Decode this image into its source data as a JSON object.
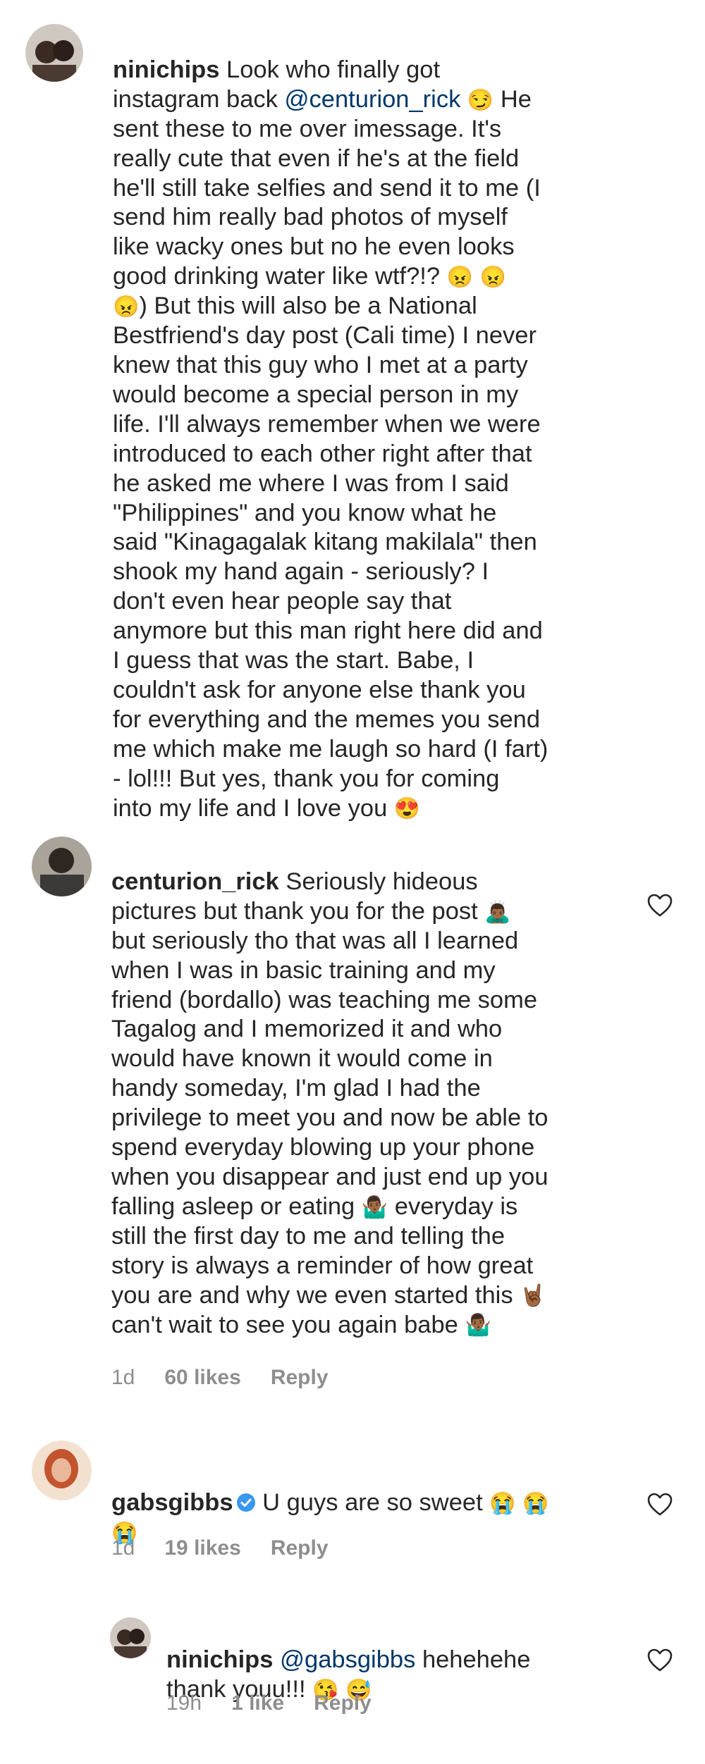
{
  "comments": [
    {
      "username": "ninichips",
      "body_lines": [
        "Look who finally got",
        "instagram back",
        "sent these to me over imessage. It's",
        "really cute that even if he's at the field",
        "he'll still take selfies and send it to me (I",
        "send him really bad photos of myself",
        "like wacky ones but no he even looks",
        "good drinking water like wtf?!?",
        ") But this will also be a National",
        "Bestfriend's day post (Cali time) I never",
        "knew that this guy who I met at a party",
        "would become a special person in my",
        "life. I'll always remember when we were",
        "introduced to each other right after that",
        "he asked me where I was from I said",
        "\"Philippines\" and you know what he",
        "said \"Kinagagalak kitang makilala\" then",
        "shook my hand again - seriously? I",
        "don't even hear people say that",
        "anymore but this man right here did and",
        "I guess that was the start. Babe, I",
        "couldn't ask for anyone else thank you",
        "for everything and the memes you send",
        "me which make me laugh so hard (I fart)",
        "- lol!!! But yes, thank you for coming",
        "into my life and I love you"
      ],
      "mention": "@centurion_rick",
      "after_mention": "He"
    },
    {
      "username": "centurion_rick",
      "body_lines": [
        "Seriously hideous",
        "pictures but thank you for the post",
        "but seriously tho that was all I learned",
        "when I was in basic training and my",
        "friend (bordallo) was teaching me some",
        "Tagalog and I memorized it and who",
        "would have known it would come in",
        "handy someday, I'm glad I had the",
        "privilege to meet you and now be able to",
        "spend everyday blowing up your phone",
        "when you disappear and just end up you",
        "falling asleep or eating",
        "everyday is",
        "still the first day to me and telling the",
        "story is always a reminder of how great",
        "you are and why we even started this",
        "can't wait to see you again babe"
      ],
      "time": "1d",
      "likes": "60 likes",
      "reply": "Reply"
    },
    {
      "username": "gabsgibbs",
      "body": "U guys are so sweet",
      "time": "1d",
      "likes": "19 likes",
      "reply": "Reply"
    },
    {
      "username": "ninichips",
      "mention": "@gabsgibbs",
      "body_rest": "hehehehe",
      "body_line2": "thank youu!!!",
      "time": "19h",
      "likes": "1 like",
      "reply": "Reply"
    }
  ],
  "icons": [
    "heart-outline-icon",
    "verified-badge-icon"
  ],
  "colors": {
    "text": "#262626",
    "meta": "#8e8e8e",
    "mention": "#00376b",
    "verified": "#3897f0"
  }
}
